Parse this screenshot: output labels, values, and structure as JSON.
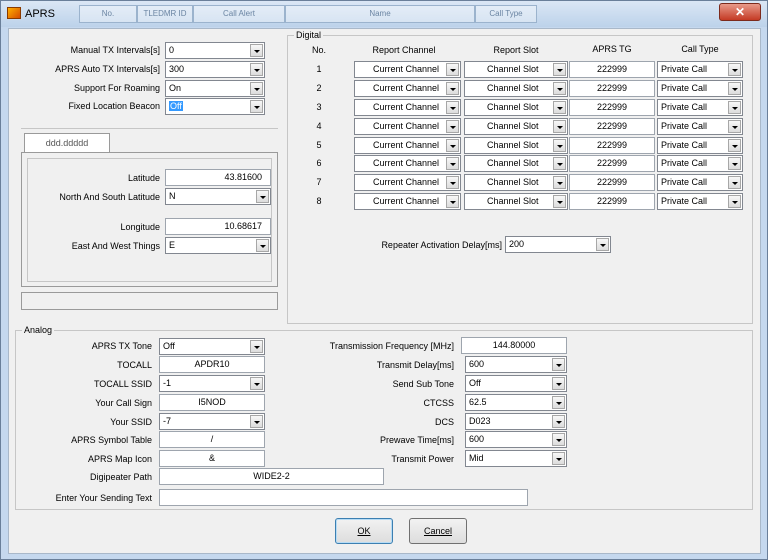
{
  "window": {
    "title": "APRS",
    "close_label": "✕"
  },
  "ghost_headers": [
    "No.",
    "TLEDMR ID",
    "Call Alert",
    "Name",
    "Call Type"
  ],
  "top_fields": [
    {
      "label": "Manual TX Intervals[s]",
      "value": "0"
    },
    {
      "label": "APRS Auto TX Intervals[s]",
      "value": "300"
    },
    {
      "label": "Support For Roaming",
      "value": "On"
    },
    {
      "label": "Fixed Location Beacon",
      "value": "Off"
    }
  ],
  "location": {
    "tab_label": "ddd.ddddd",
    "latitude_label": "Latitude",
    "latitude_value": "43.81600",
    "ns_label": "North And South Latitude",
    "ns_value": "N",
    "longitude_label": "Longitude",
    "longitude_value": "10.68617",
    "ew_label": "East  And West Things",
    "ew_value": "E"
  },
  "digital": {
    "group_label": "Digital",
    "headers": {
      "no": "No.",
      "report_channel": "Report Channel",
      "report_slot": "Report Slot",
      "aprs_tg": "APRS TG",
      "call_type": "Call Type"
    },
    "rows": [
      {
        "no": "1",
        "channel": "Current Channel",
        "slot": "Channel Slot",
        "tg": "222999",
        "call_type": "Private Call"
      },
      {
        "no": "2",
        "channel": "Current Channel",
        "slot": "Channel Slot",
        "tg": "222999",
        "call_type": "Private Call"
      },
      {
        "no": "3",
        "channel": "Current Channel",
        "slot": "Channel Slot",
        "tg": "222999",
        "call_type": "Private Call"
      },
      {
        "no": "4",
        "channel": "Current Channel",
        "slot": "Channel Slot",
        "tg": "222999",
        "call_type": "Private Call"
      },
      {
        "no": "5",
        "channel": "Current Channel",
        "slot": "Channel Slot",
        "tg": "222999",
        "call_type": "Private Call"
      },
      {
        "no": "6",
        "channel": "Current Channel",
        "slot": "Channel Slot",
        "tg": "222999",
        "call_type": "Private Call"
      },
      {
        "no": "7",
        "channel": "Current Channel",
        "slot": "Channel Slot",
        "tg": "222999",
        "call_type": "Private Call"
      },
      {
        "no": "8",
        "channel": "Current Channel",
        "slot": "Channel Slot",
        "tg": "222999",
        "call_type": "Private Call"
      }
    ],
    "repeater_delay_label": "Repeater Activation Delay[ms]",
    "repeater_delay_value": "200"
  },
  "analog": {
    "group_label": "Analog",
    "aprs_tx_tone_label": "APRS TX Tone",
    "aprs_tx_tone_value": "Off",
    "tocall_label": "TOCALL",
    "tocall_value": "APDR10",
    "tocall_ssid_label": "TOCALL SSID",
    "tocall_ssid_value": "-1",
    "your_call_sign_label": "Your Call Sign",
    "your_call_sign_value": "I5NOD",
    "your_ssid_label": "Your SSID",
    "your_ssid_value": "-7",
    "symbol_table_label": "APRS Symbol Table",
    "symbol_table_value": "/",
    "map_icon_label": "APRS Map Icon",
    "map_icon_value": "&",
    "digipeater_label": "Digipeater Path",
    "digipeater_value": "WIDE2-2",
    "sending_text_label": "Enter Your Sending Text",
    "sending_text_value": "",
    "tx_freq_label": "Transmission Frequency [MHz]",
    "tx_freq_value": "144.80000",
    "tx_delay_label": "Transmit Delay[ms]",
    "tx_delay_value": "600",
    "send_sub_tone_label": "Send Sub Tone",
    "send_sub_tone_value": "Off",
    "ctcss_label": "CTCSS",
    "ctcss_value": "62.5",
    "dcs_label": "DCS",
    "dcs_value": "D023",
    "prewave_label": "Prewave Time[ms]",
    "prewave_value": "600",
    "tx_power_label": "Transmit Power",
    "tx_power_value": "Mid"
  },
  "buttons": {
    "ok": "OK",
    "cancel": "Cancel"
  }
}
